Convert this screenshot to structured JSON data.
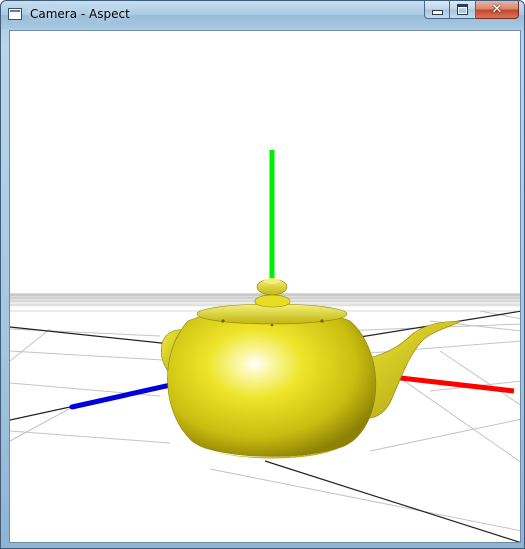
{
  "window": {
    "title": "Camera - Aspect"
  },
  "caption_buttons": {
    "minimize": "minimize-icon",
    "maximize": "maximize-icon",
    "close": "close-icon"
  },
  "scene": {
    "object": "teapot",
    "object_color": "#f0ea2a",
    "axis_colors": {
      "x": "#ff0000",
      "y": "#00ee00",
      "z": "#0000dd"
    },
    "background": "#ffffff",
    "grid_color": "#c8c8c8"
  }
}
